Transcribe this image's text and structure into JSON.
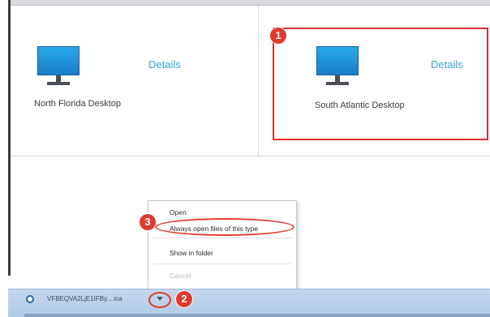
{
  "desktops": [
    {
      "name": "North Florida Desktop",
      "details_label": "Details",
      "icon": "monitor-icon"
    },
    {
      "name": "South Atlantic Desktop",
      "details_label": "Details",
      "icon": "monitor-icon"
    }
  ],
  "callouts": {
    "step1": "1",
    "step2": "2",
    "step3": "3",
    "color": "#e03a2e"
  },
  "context_menu": {
    "items": [
      {
        "label": "Open",
        "enabled": true
      },
      {
        "label": "Always open files of this type",
        "enabled": true
      },
      {
        "label": "Show in folder",
        "enabled": true
      },
      {
        "label": "Cancel",
        "enabled": false
      }
    ]
  },
  "download_bar": {
    "filename": "VFBEQVA2LjE1IFBy....ica",
    "file_icon": "download-file-icon",
    "menu_arrow_icon": "chevron-down-icon"
  },
  "colors": {
    "link": "#3a9fd8",
    "highlight": "#e0302f",
    "download_bar": "#c3d7ee"
  }
}
